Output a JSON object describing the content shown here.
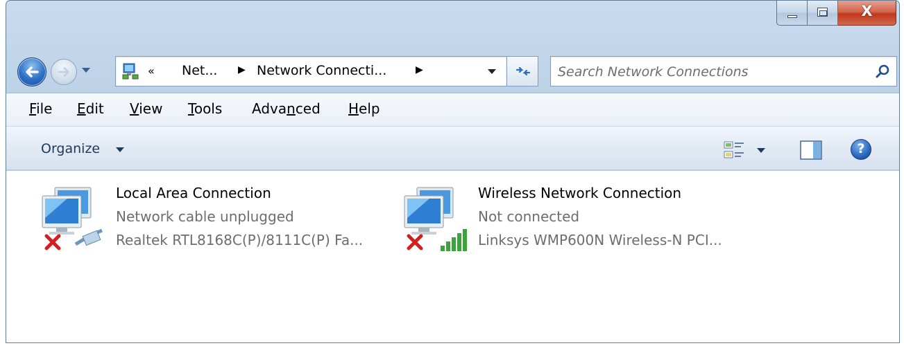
{
  "window": {
    "caption_buttons": [
      "minimize",
      "maximize",
      "close"
    ],
    "close_glyph": "X"
  },
  "nav": {
    "back_icon": "back-arrow-icon",
    "forward_icon": "forward-arrow-icon",
    "address": {
      "overflow": "«",
      "crumbs": [
        "Net...",
        "Network Connecti..."
      ]
    },
    "search": {
      "placeholder": "Search Network Connections"
    }
  },
  "menu": {
    "items": [
      {
        "label": "File",
        "accel": "F"
      },
      {
        "label": "Edit",
        "accel": "E"
      },
      {
        "label": "View",
        "accel": "V"
      },
      {
        "label": "Tools",
        "accel": "T"
      },
      {
        "label": "Advanced",
        "accel": "n"
      },
      {
        "label": "Help",
        "accel": "H"
      }
    ]
  },
  "toolbar": {
    "organize_label": "Organize",
    "help_glyph": "?"
  },
  "connections": [
    {
      "name": "Local Area Connection",
      "status": "Network cable unplugged",
      "device": "Realtek RTL8168C(P)/8111C(P) Fa...",
      "type_icon": "ethernet-cable-icon",
      "error_icon": "red-x-icon"
    },
    {
      "name": "Wireless Network Connection",
      "status": "Not connected",
      "device": "Linksys WMP600N Wireless-N PCI...",
      "type_icon": "signal-bars-icon",
      "error_icon": "red-x-icon"
    }
  ],
  "colors": {
    "accent_blue": "#2c6fc6",
    "status_gray": "#6d6d6d",
    "error_red": "#d21f1f",
    "signal_green": "#3aa43a"
  }
}
